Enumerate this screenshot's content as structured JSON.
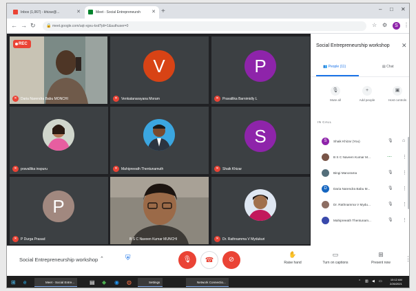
{
  "browser": {
    "tabs": [
      {
        "label": "Inbox (1,067) - khizar@...",
        "favicon_color": "#ea4335"
      },
      {
        "label": "Meet - Social Entrepreneursh",
        "favicon_color": "#00832d"
      }
    ],
    "new_tab": "+",
    "url": "meet.google.com/uqt-xgvu-kxd?pli=1&authuser=0",
    "profile_initial": "S"
  },
  "tiles": [
    {
      "name": "Daria Narendra Babu MONCHI",
      "kind": "video",
      "rec": "REC"
    },
    {
      "name": "Venkatanarayana Moram",
      "initial": "V",
      "color": "#d84315"
    },
    {
      "name": "Pravallika Barnimidly L",
      "initial": "P",
      "color": "#8e24aa"
    },
    {
      "name": "pravallika inspuru",
      "kind": "photo"
    },
    {
      "name": "Mahipreeath Thentunamuth",
      "kind": "photo"
    },
    {
      "name": "Shaik Khizar",
      "initial": "S",
      "color": "#8e24aa"
    },
    {
      "name": "P Durga Prasad",
      "initial": "P",
      "color": "#a1887f"
    },
    {
      "name": "B S C Naveen Kumar MUNCHI",
      "kind": "video"
    },
    {
      "name": "Dr. Rathnamma V Mydukuri",
      "kind": "photo"
    }
  ],
  "panel": {
    "title": "Social Entrepreneurship workshop",
    "tabs": {
      "people": "People (11)",
      "chat": "Chat"
    },
    "actions": [
      {
        "label": "Mute all",
        "icon": "mic-off-icon"
      },
      {
        "label": "Add people",
        "icon": "add-person-icon"
      },
      {
        "label": "Host controls",
        "icon": "host-controls-icon"
      }
    ],
    "in_call": "IN CALL",
    "participants": [
      {
        "name": "Shaik Khizar (You)",
        "initial": "S",
        "color": "#8e24aa"
      },
      {
        "name": "B S C Naveen Kumar M...",
        "initial": "",
        "color": "#795548"
      },
      {
        "name": "Bingi Manorama",
        "initial": "",
        "color": "#546e7a"
      },
      {
        "name": "Daria Narendra Babu M...",
        "initial": "D",
        "color": "#1565c0"
      },
      {
        "name": "Dr. Rathnamma V Mydu...",
        "initial": "",
        "color": "#8d6e63"
      },
      {
        "name": "Mahipreeath Thentunam...",
        "initial": "",
        "color": "#3949ab"
      }
    ]
  },
  "bottom": {
    "meeting_name": "Social Entrepreneurship workshop",
    "raise_hand": "Raise hand",
    "captions": "Turn on captions",
    "present": "Present now"
  },
  "taskbar": {
    "apps": [
      {
        "label": "Meet - Social Entre..."
      },
      {
        "label": "Settings"
      },
      {
        "label": "Network Connectio..."
      }
    ],
    "time": "10:12 AM",
    "date": "2/26/2021"
  }
}
